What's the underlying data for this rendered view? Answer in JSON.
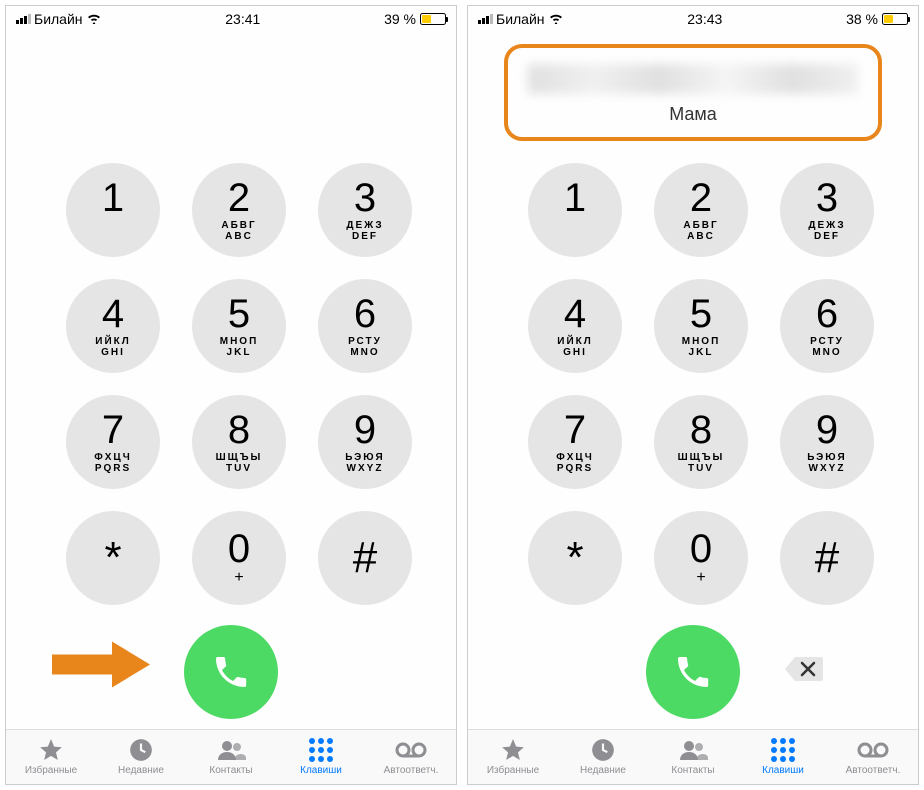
{
  "left": {
    "status": {
      "carrier": "Билайн",
      "time": "23:41",
      "battery_text": "39 %"
    }
  },
  "right": {
    "status": {
      "carrier": "Билайн",
      "time": "23:43",
      "battery_text": "38 %"
    },
    "contact_name": "Мама"
  },
  "keys": [
    {
      "digit": "1",
      "ru": "",
      "en": ""
    },
    {
      "digit": "2",
      "ru": "АБВГ",
      "en": "ABC"
    },
    {
      "digit": "3",
      "ru": "ДЕЖЗ",
      "en": "DEF"
    },
    {
      "digit": "4",
      "ru": "ИЙКЛ",
      "en": "GHI"
    },
    {
      "digit": "5",
      "ru": "МНОП",
      "en": "JKL"
    },
    {
      "digit": "6",
      "ru": "РСТУ",
      "en": "MNO"
    },
    {
      "digit": "7",
      "ru": "ФХЦЧ",
      "en": "PQRS"
    },
    {
      "digit": "8",
      "ru": "ШЩЪЫ",
      "en": "TUV"
    },
    {
      "digit": "9",
      "ru": "ЬЭЮЯ",
      "en": "WXYZ"
    },
    {
      "digit": "*",
      "ru": "",
      "en": ""
    },
    {
      "digit": "0",
      "ru": "",
      "en": "+"
    },
    {
      "digit": "#",
      "ru": "",
      "en": ""
    }
  ],
  "tabs": [
    {
      "id": "favorites",
      "label": "Избранные"
    },
    {
      "id": "recents",
      "label": "Недавние"
    },
    {
      "id": "contacts",
      "label": "Контакты"
    },
    {
      "id": "keypad",
      "label": "Клавиши"
    },
    {
      "id": "voicemail",
      "label": "Автоответч."
    }
  ],
  "colors": {
    "annotation": "#e8861c",
    "call_green": "#4cd964",
    "active_blue": "#007aff"
  }
}
